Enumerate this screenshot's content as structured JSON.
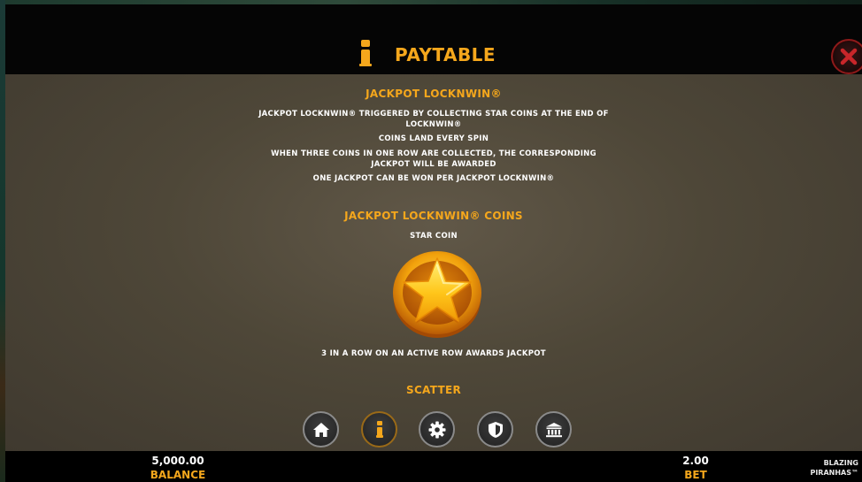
{
  "header": {
    "title": "PAYTABLE",
    "info_icon": "info-icon",
    "close_icon": "close-icon"
  },
  "sections": {
    "jackpot": {
      "heading": "JACKPOT LOCKNWIN®",
      "line1": "JACKPOT LOCKNWIN® TRIGGERED BY COLLECTING STAR COINS AT THE END OF LOCKNWIN®",
      "line2": "COINS LAND EVERY SPIN",
      "line3": "WHEN THREE COINS IN ONE ROW ARE COLLECTED, THE CORRESPONDING JACKPOT WILL BE AWARDED",
      "line4": "ONE JACKPOT CAN BE WON PER JACKPOT LOCKNWIN®"
    },
    "coins": {
      "heading": "JACKPOT LOCKNWIN® COINS",
      "coin_label": "STAR COIN",
      "coin_icon": "star-coin-icon",
      "description": "3 IN A ROW ON AN ACTIVE ROW AWARDS JACKPOT"
    },
    "scatter": {
      "heading": "SCATTER"
    }
  },
  "menu": [
    {
      "icon": "home-icon",
      "active": false
    },
    {
      "icon": "info-icon",
      "active": true
    },
    {
      "icon": "gear-icon",
      "active": false
    },
    {
      "icon": "shield-icon",
      "active": false
    },
    {
      "icon": "bank-icon",
      "active": false
    }
  ],
  "footer": {
    "balance_value": "5,000.00",
    "balance_label": "BALANCE",
    "bet_value": "2.00",
    "bet_label": "BET",
    "logo_line1": "BLAZING",
    "logo_line2": "PIRANHAS™"
  },
  "colors": {
    "accent": "#f5a71c",
    "close_red": "#c8262a",
    "panel": "#4e4738",
    "header_bg": "#050505"
  }
}
